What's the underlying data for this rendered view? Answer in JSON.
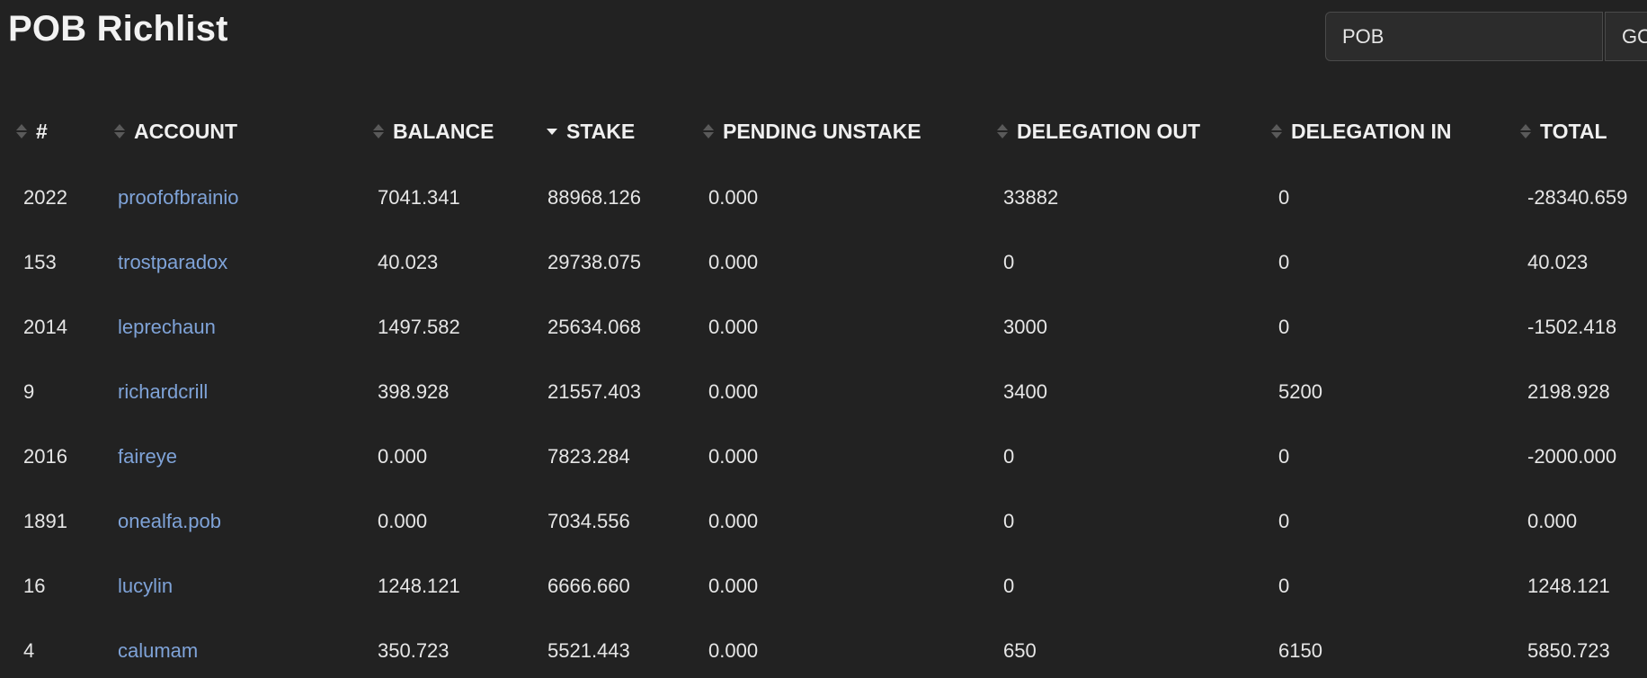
{
  "header": {
    "title": "POB Richlist"
  },
  "search": {
    "value": "POB",
    "button_label": "GO"
  },
  "table": {
    "columns": [
      {
        "label": "#",
        "sorted": false
      },
      {
        "label": "ACCOUNT",
        "sorted": false
      },
      {
        "label": "BALANCE",
        "sorted": false
      },
      {
        "label": "STAKE",
        "sorted": true,
        "direction": "desc"
      },
      {
        "label": "PENDING UNSTAKE",
        "sorted": false
      },
      {
        "label": "DELEGATION OUT",
        "sorted": false
      },
      {
        "label": "DELEGATION IN",
        "sorted": false
      },
      {
        "label": "TOTAL",
        "sorted": false
      }
    ],
    "rows": [
      {
        "rank": "2022",
        "account": "proofofbrainio",
        "balance": "7041.341",
        "stake": "88968.126",
        "pending_unstake": "0.000",
        "delegation_out": "33882",
        "delegation_in": "0",
        "total": "-28340.659"
      },
      {
        "rank": "153",
        "account": "trostparadox",
        "balance": "40.023",
        "stake": "29738.075",
        "pending_unstake": "0.000",
        "delegation_out": "0",
        "delegation_in": "0",
        "total": "40.023"
      },
      {
        "rank": "2014",
        "account": "leprechaun",
        "balance": "1497.582",
        "stake": "25634.068",
        "pending_unstake": "0.000",
        "delegation_out": "3000",
        "delegation_in": "0",
        "total": "-1502.418"
      },
      {
        "rank": "9",
        "account": "richardcrill",
        "balance": "398.928",
        "stake": "21557.403",
        "pending_unstake": "0.000",
        "delegation_out": "3400",
        "delegation_in": "5200",
        "total": "2198.928"
      },
      {
        "rank": "2016",
        "account": "faireye",
        "balance": "0.000",
        "stake": "7823.284",
        "pending_unstake": "0.000",
        "delegation_out": "0",
        "delegation_in": "0",
        "total": "-2000.000"
      },
      {
        "rank": "1891",
        "account": "onealfa.pob",
        "balance": "0.000",
        "stake": "7034.556",
        "pending_unstake": "0.000",
        "delegation_out": "0",
        "delegation_in": "0",
        "total": "0.000"
      },
      {
        "rank": "16",
        "account": "lucylin",
        "balance": "1248.121",
        "stake": "6666.660",
        "pending_unstake": "0.000",
        "delegation_out": "0",
        "delegation_in": "0",
        "total": "1248.121"
      },
      {
        "rank": "4",
        "account": "calumam",
        "balance": "350.723",
        "stake": "5521.443",
        "pending_unstake": "0.000",
        "delegation_out": "650",
        "delegation_in": "6150",
        "total": "5850.723"
      }
    ]
  },
  "colors": {
    "background": "#222222",
    "text": "#e6e6e6",
    "link": "#7fa3d8",
    "input_background": "#2c2c2c",
    "input_border": "#4a4a4a"
  },
  "icons": {
    "sort": "sort-both-icon",
    "sort_active": "sort-desc-icon"
  }
}
